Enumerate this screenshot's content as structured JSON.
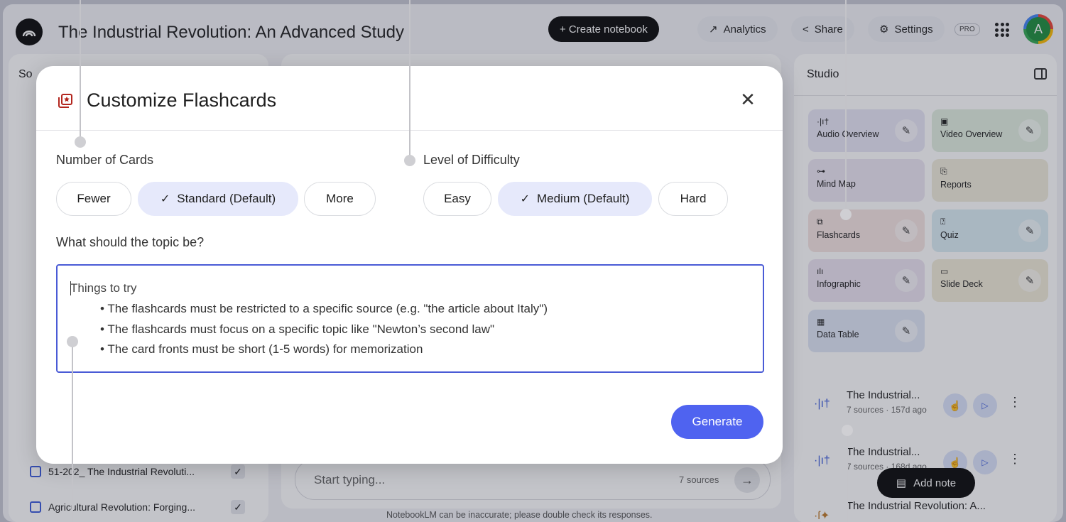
{
  "header": {
    "notebook_title": "The Industrial Revolution: An Advanced Study",
    "create_label": "+ Create notebook",
    "analytics_label": "Analytics",
    "share_label": "Share",
    "settings_label": "Settings",
    "pro_label": "PRO",
    "avatar_initial": "A"
  },
  "sources": {
    "title_visible": "So",
    "rows": [
      {
        "label": "51-202_ The Industrial Revoluti..."
      },
      {
        "label": "Agricultural Revolution: Forging..."
      }
    ]
  },
  "chat": {
    "placeholder": "Start typing...",
    "source_count": "7 sources",
    "disclaimer": "NotebookLM can be inaccurate; please double check its responses."
  },
  "studio": {
    "title": "Studio",
    "tiles": [
      {
        "label": "Audio Overview",
        "color": "#e8e6f6"
      },
      {
        "label": "Video Overview",
        "color": "#e2efe1"
      },
      {
        "label": "Mind Map",
        "color": "#ece6f3"
      },
      {
        "label": "Reports",
        "color": "#f0ecdc"
      },
      {
        "label": "Flashcards",
        "color": "#f6e5e2"
      },
      {
        "label": "Quiz",
        "color": "#dcedf4"
      },
      {
        "label": "Infographic",
        "color": "#ece4f2"
      },
      {
        "label": "Slide Deck",
        "color": "#f1ecd9"
      },
      {
        "label": "Data Table",
        "color": "#e0e6f6"
      }
    ],
    "notes": [
      {
        "title": "The Industrial...",
        "meta": "7 sources · 157d ago"
      },
      {
        "title": "The Industrial...",
        "meta": "7 sources · 168d ago"
      },
      {
        "title": "The Industrial Revolution: A...",
        "meta": ""
      }
    ],
    "add_note_label": "Add note"
  },
  "dialog": {
    "title": "Customize Flashcards",
    "number_label": "Number of Cards",
    "number_options": [
      "Fewer",
      "Standard (Default)",
      "More"
    ],
    "number_selected": "Standard (Default)",
    "difficulty_label": "Level of Difficulty",
    "difficulty_options": [
      "Easy",
      "Medium (Default)",
      "Hard"
    ],
    "difficulty_selected": "Medium (Default)",
    "topic_label": "What should the topic be?",
    "topic_placeholder_head": "Things to try",
    "topic_tips": [
      "• The flashcards must be restricted to a specific source (e.g. \"the article about Italy\")",
      "• The flashcards must focus on a specific topic like \"Newton’s second law\"",
      "• The card fronts must be short (1-5 words) for memorization"
    ],
    "generate_label": "Generate",
    "accent_color": "#4f63f0"
  }
}
